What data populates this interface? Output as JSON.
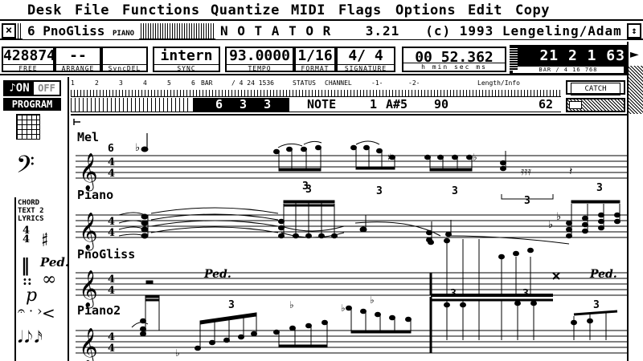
{
  "menu": [
    "Desk",
    "File",
    "Functions",
    "Quantize",
    "MIDI",
    "Flags",
    "Options",
    "Edit",
    "Copy"
  ],
  "title": {
    "close_glyph": "×",
    "full_glyph": "↕",
    "track_num": "6",
    "instrument_name": "PnoGliss",
    "instrument_label": "PIANO",
    "app_name": "N O T A T O R",
    "version": "3.21",
    "copyright": "(c) 1993 Lengeling/Adam"
  },
  "infobar": {
    "free_value": "428874",
    "free_label": "FREE",
    "arrange_value": "--",
    "arrange_label": "ARRANGE",
    "syncdel_label": "SyncDEL",
    "sync_value": "intern",
    "sync_label": "SYNC",
    "tempo_value": "93.0000",
    "tempo_label": "TEMPO",
    "format_value": "1/16",
    "format_label": "FORMAT",
    "signature_value": "4/  4",
    "signature_label": "SIGNATURE",
    "clock_value": "00 52.362",
    "clock_label": "h  min  sec  ms",
    "bar_value": "21  2  1 63",
    "bar_label": "BAR  / 4  16  768"
  },
  "palette": {
    "on_label": "♪ON",
    "off_label": "OFF",
    "program_label": "PROGRAM",
    "text_lines": [
      "CHORD",
      "TEXT 2",
      "LYRICS"
    ]
  },
  "status_header": {
    "bar1": "1",
    "bar2": "2",
    "bar3": "3",
    "bar4": "4",
    "bar5": "5",
    "bar6": "6",
    "bar_lbl": "BAR",
    "res": "/ 4 24 1536",
    "status": "STATUS",
    "channel": "CHANNEL",
    "col1": "-1-",
    "col2": "-2-",
    "length": "Length/Info"
  },
  "status_row": {
    "position": "6 3 3 1",
    "status": "NOTE",
    "channel": "1",
    "pitch": "A#5",
    "velocity": "90",
    "length": "62"
  },
  "catch_label": "CATCH",
  "staves": [
    {
      "name": "Mel",
      "bar_number": "6"
    },
    {
      "name": "Piano"
    },
    {
      "name": "PnoGliss"
    },
    {
      "name": "Piano2"
    }
  ],
  "score_marks": {
    "time_sig_top": "4",
    "time_sig_bottom": "4",
    "tuplet": "3",
    "pedal": "Ped."
  }
}
